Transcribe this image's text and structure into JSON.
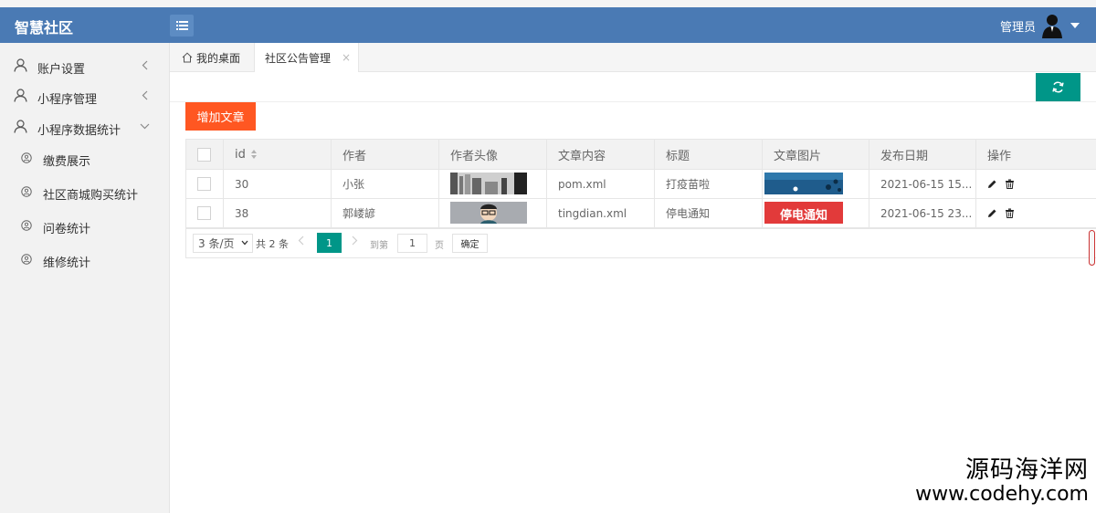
{
  "app": {
    "title": "智慧社区"
  },
  "header": {
    "user_name": "管理员"
  },
  "sidebar": {
    "items": [
      {
        "label": "账户设置",
        "icon": "user-icon",
        "expanded": false
      },
      {
        "label": "小程序管理",
        "icon": "user-icon",
        "expanded": false
      },
      {
        "label": "小程序数据统计",
        "icon": "user-icon",
        "expanded": true
      }
    ],
    "sub_items": [
      {
        "label": "缴费展示"
      },
      {
        "label": "社区商城购买统计"
      },
      {
        "label": "问卷统计"
      },
      {
        "label": "维修统计"
      }
    ]
  },
  "tabs": [
    {
      "label": "我的桌面",
      "icon": "home-icon",
      "active": false
    },
    {
      "label": "社区公告管理",
      "active": true,
      "close": "×"
    }
  ],
  "toolbar": {
    "add_label": "增加文章"
  },
  "table": {
    "columns": [
      "id",
      "作者",
      "作者头像",
      "文章内容",
      "标题",
      "文章图片",
      "发布日期",
      "操作"
    ],
    "rows": [
      {
        "id": "30",
        "author": "小张",
        "content": "pom.xml",
        "title": "打疫苗啦",
        "date": "2021-06-15 15...",
        "image_text": ""
      },
      {
        "id": "38",
        "author": "郭嵝諺",
        "content": "tingdian.xml",
        "title": "停电通知",
        "date": "2021-06-15 23...",
        "image_text": "停电通知"
      }
    ]
  },
  "pagination": {
    "page_size": "3 条/页",
    "total": "共 2 条",
    "current": "1",
    "goto_label": "到第",
    "goto_value": "1",
    "page_label": "页",
    "confirm_label": "确定"
  },
  "watermark": {
    "cn": "源码海洋网",
    "url": "www.codehy.com"
  },
  "colors": {
    "header": "#4a7ab4",
    "primary": "#009688",
    "danger": "#ff5722",
    "sidebar": "#f2f2f2"
  }
}
